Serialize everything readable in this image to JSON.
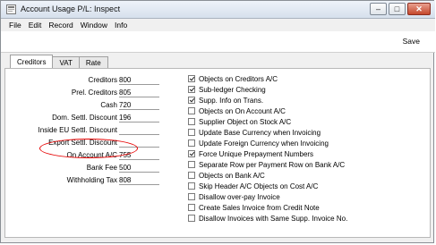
{
  "window": {
    "title": "Account Usage P/L: Inspect"
  },
  "menu": [
    "File",
    "Edit",
    "Record",
    "Window",
    "Info"
  ],
  "toolbar": {
    "save_label": "Save"
  },
  "tabs": [
    {
      "label": "Creditors",
      "active": true
    },
    {
      "label": "VAT",
      "active": false
    },
    {
      "label": "Rate",
      "active": false
    }
  ],
  "fields": [
    {
      "label": "Creditors",
      "value": "800"
    },
    {
      "label": "Prel. Creditors",
      "value": "805"
    },
    {
      "label": "Cash",
      "value": "720"
    },
    {
      "label": "Dom. Settl. Discount",
      "value": "196"
    },
    {
      "label": "Inside EU Settl. Discount",
      "value": ""
    },
    {
      "label": "Export Settl. Discount",
      "value": ""
    },
    {
      "label": "On Account A/C",
      "value": "755"
    },
    {
      "label": "Bank Fee",
      "value": "500"
    },
    {
      "label": "Withholding Tax",
      "value": "808"
    }
  ],
  "checkboxes": [
    {
      "label": "Objects on Creditors A/C",
      "checked": true
    },
    {
      "label": "Sub-ledger Checking",
      "checked": true
    },
    {
      "label": "Supp. Info on Trans.",
      "checked": true
    },
    {
      "label": "Objects on On Account A/C",
      "checked": false
    },
    {
      "label": "Supplier Object on Stock A/C",
      "checked": false
    },
    {
      "label": "Update Base Currency when Invoicing",
      "checked": false
    },
    {
      "label": "Update Foreign Currency when Invoicing",
      "checked": false
    },
    {
      "label": "Force Unique Prepayment Numbers",
      "checked": true
    },
    {
      "label": "Separate Row per Payment Row on Bank A/C",
      "checked": false
    },
    {
      "label": "Objects on Bank A/C",
      "checked": false
    },
    {
      "label": "Skip Header A/C Objects on Cost A/C",
      "checked": false
    },
    {
      "label": "Disallow over-pay Invoice",
      "checked": false
    },
    {
      "label": "Create Sales Invoice from Credit Note",
      "checked": false
    },
    {
      "label": "Disallow Invoices with Same Supp. Invoice No.",
      "checked": false
    }
  ],
  "colors": {
    "annotation": "#e60000"
  }
}
